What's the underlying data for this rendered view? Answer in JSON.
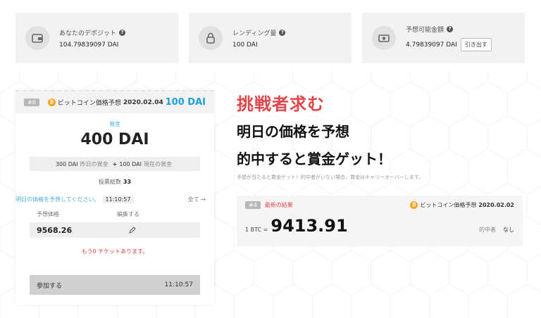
{
  "stats": [
    {
      "label": "あなたのデポジット",
      "value": "104.79839097 DAI",
      "icon": "wallet-icon"
    },
    {
      "label": "レンディング量",
      "value": "100 DAI",
      "icon": "lock-icon"
    },
    {
      "label": "予想可能金額",
      "value": "4.79839097 DAI",
      "icon": "money-icon",
      "action": "引き出す"
    }
  ],
  "card": {
    "id": "#6",
    "coin_symbol": "₿",
    "pair": "ビットコイン価格予想",
    "date": "2020.02.04",
    "bet": "100 DAI",
    "prize_label": "賞金",
    "prize": "400 DAI",
    "yesterday_amount": "300 DAI",
    "yesterday_label": "昨日の賞金",
    "plus": "+",
    "current_amount": "100 DAI",
    "current_label": "現在の賞金",
    "votes_label": "投票総数",
    "votes": "33",
    "predict_prompt": "明日の価格を予想してください。",
    "time": "11:10:57",
    "all_link": "全て →",
    "col_price": "予想価格",
    "col_edit": "編集する",
    "predicted_price": "9568.26",
    "tickets_note": "もう0 チケットあります。",
    "join_label": "参加する",
    "join_time": "11:10:57"
  },
  "hero": {
    "title": "挑戦者求む",
    "line1": "明日の価格を予想",
    "line2": "的中すると賞金ゲット！",
    "note": "予想が当たると賞金ゲット！的中者がいない場合、賞金はキャリーオーバーします。"
  },
  "latest": {
    "id": "#4",
    "title": "最新の結果",
    "pair": "ビットコイン価格予想",
    "date": "2020.02.02",
    "btc_label": "1 BTC =",
    "price": "9413.91",
    "winner_label": "的中者",
    "winner_value": "なし"
  },
  "colors": {
    "accent_red": "#e0474c",
    "accent_blue": "#1f9fd8",
    "coin_orange": "#f7a316"
  }
}
